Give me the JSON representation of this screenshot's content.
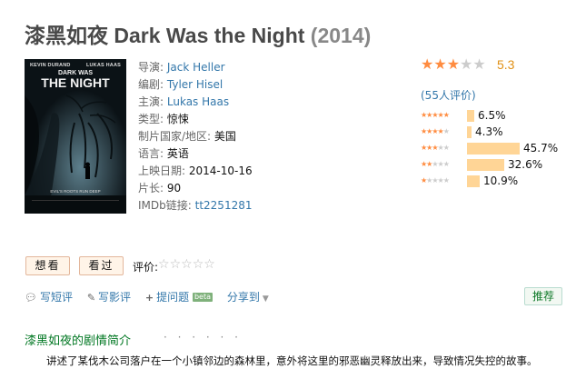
{
  "title": {
    "cn": "漆黑如夜",
    "en": "Dark Was the Night",
    "year": "(2014)"
  },
  "poster": {
    "actor_left": "KEVIN DURAND",
    "actor_right": "LUKAS HAAS",
    "title_small": "DARK WAS",
    "title_big": "THE NIGHT",
    "tagline": "EVIL'S ROOTS RUN DEEP"
  },
  "info": {
    "director_label": "导演:",
    "director": "Jack Heller",
    "writer_label": "编剧:",
    "writer": "Tyler Hisel",
    "cast_label": "主演:",
    "cast": "Lukas Haas",
    "genre_label": "类型:",
    "genre": "惊悚",
    "country_label": "制片国家/地区:",
    "country": "美国",
    "language_label": "语言:",
    "language": "英语",
    "release_label": "上映日期:",
    "release": "2014-10-16",
    "runtime_label": "片长:",
    "runtime": "90",
    "imdb_label": "IMDb链接:",
    "imdb": "tt2251281"
  },
  "rating": {
    "score": "5.3",
    "stars_filled": 3,
    "votes": "(55人评价)",
    "distribution": [
      {
        "stars": 5,
        "percent": 6.5,
        "label": "6.5%"
      },
      {
        "stars": 4,
        "percent": 4.3,
        "label": "4.3%"
      },
      {
        "stars": 3,
        "percent": 45.7,
        "label": "45.7%"
      },
      {
        "stars": 2,
        "percent": 32.6,
        "label": "32.6%"
      },
      {
        "stars": 1,
        "percent": 10.9,
        "label": "10.9%"
      }
    ]
  },
  "buttons": {
    "want": "想看",
    "seen": "看过",
    "rate_label": "评价:"
  },
  "actions": {
    "short_review": "写短评",
    "review": "写影评",
    "ask": "提问题",
    "beta": "beta",
    "share": "分享到",
    "recommend": "推荐"
  },
  "summary": {
    "title": "漆黑如夜的剧情简介",
    "dots": "· · · · · ·",
    "text": "讲述了某伐木公司落户在一个小镇邻边的森林里，意外将这里的邪恶幽灵释放出来，导致情况失控的故事。"
  },
  "colors": {
    "link": "#3377aa",
    "star": "#ff8c40",
    "bar": "#ffd596",
    "section": "#007722"
  }
}
